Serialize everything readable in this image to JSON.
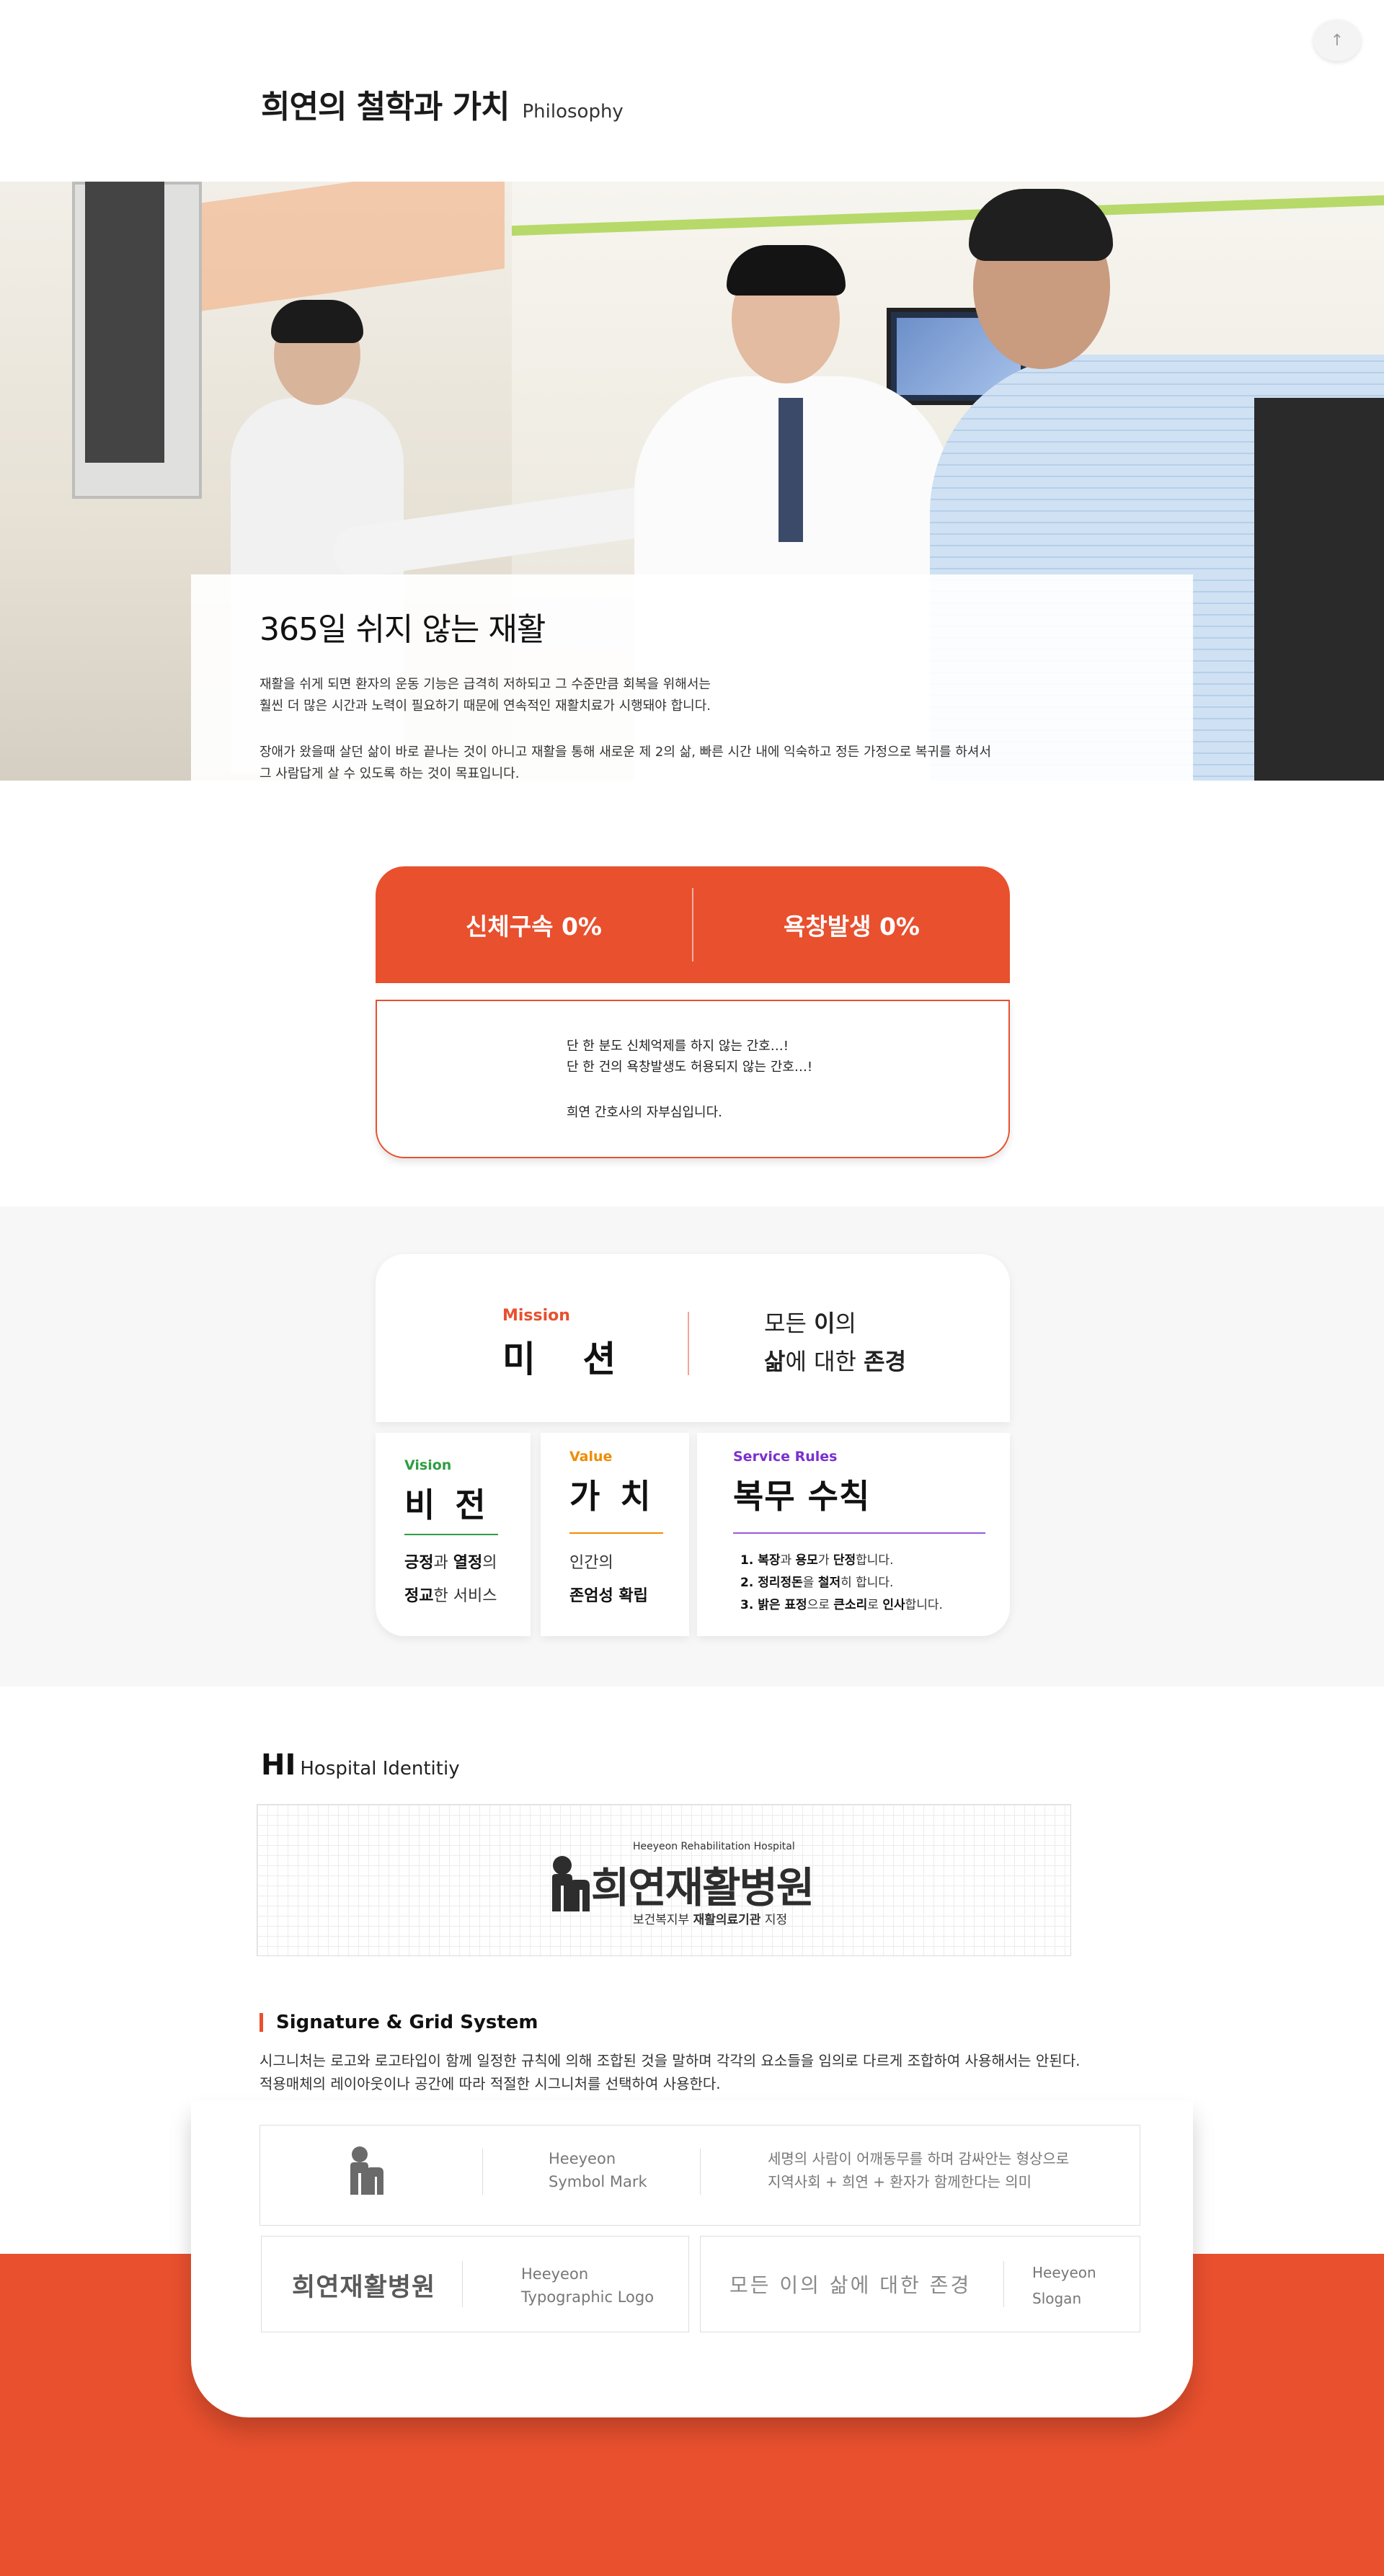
{
  "top_button": {
    "icon": "arrow-up-icon"
  },
  "header": {
    "title": "희연의 철학과 가치",
    "subtitle": "Philosophy"
  },
  "hero": {
    "heading": "365일 쉬지 않는 재활",
    "para1_line1": "재활을 쉬게 되면 환자의 운동 기능은 급격히 저하되고 그 수준만큼 회복을 위해서는",
    "para1_line2": " 훨씬 더 많은 시간과 노력이 필요하기 때문에 연속적인 재활치료가 시행돼야 합니다.",
    "para2_line1": " 장애가 왔을때 살던 삶이 바로 끝나는 것이 아니고 재활을 통해 새로운 제 2의 삶, 빠른 시간 내에 익숙하고 정든 가정으로 복귀를 하셔서",
    "para2_line2": "그 사람답게 살 수 있도록 하는 것이 목표입니다."
  },
  "zero": {
    "item1": "신체구속 0%",
    "item2": "욕창발생 0%",
    "line1": "단 한 분도 신체억제를 하지 않는 간호…!",
    "line2": "단 한 건의 욕창발생도 허용되지 않는 간호…!",
    "line3": "희연 간호사의 자부심입니다."
  },
  "mission": {
    "tag": "Mission",
    "title": "미 션",
    "stmt_a": "모든 ",
    "stmt_b": "이",
    "stmt_c": "의",
    "stmt_d": "삶",
    "stmt_e": "에 대한 ",
    "stmt_f": "존경"
  },
  "vision": {
    "tag": "Vision",
    "title": "비 전",
    "l1_a": "긍정",
    "l1_b": "과 ",
    "l1_c": "열정",
    "l1_d": "의",
    "l2_a": "정교",
    "l2_b": "한 서비스"
  },
  "value": {
    "tag": "Value",
    "title": "가 치",
    "l1": "인간의",
    "l2": "존엄성 확립"
  },
  "rules": {
    "tag": "Service Rules",
    "title": "복무 수칙",
    "r1_a": "1. 복장",
    "r1_b": "과 ",
    "r1_c": "용모",
    "r1_d": "가 ",
    "r1_e": "단정",
    "r1_f": "합니다.",
    "r2_a": "2. 정리정돈",
    "r2_b": "을 ",
    "r2_c": "철저",
    "r2_d": "히 합니다.",
    "r3_a": "3. 밝은 표정",
    "r3_b": "으로 ",
    "r3_c": "큰소리",
    "r3_d": "로 ",
    "r3_e": "인사",
    "r3_f": "합니다."
  },
  "hi": {
    "title_a": "HI",
    "title_b": "Hospital Identitiy",
    "logo_sub": "Heeyeon Rehabilitation Hospital",
    "logo_main": "희연재활병원",
    "caption_a": "보건복지부 ",
    "caption_b": "재활의료기관",
    "caption_c": " 지정"
  },
  "signature": {
    "title": "Signature & Grid System",
    "desc1": "시그니처는 로고와 로고타입이 함께 일정한 규칙에 의해 조합된 것을 말하며 각각의 요소들을 임의로 다르게 조합하여 사용해서는 안된다.",
    "desc2": "적용매체의 레이아웃이나 공간에 따라 적절한 시그니처를 선택하여 사용한다.",
    "symbol_label1": "Heeyeon",
    "symbol_label2": "Symbol Mark",
    "symbol_desc1": "세명의 사람이 어깨동무를 하며 감싸안는 형상으로",
    "symbol_desc2": "지역사회 + 희연 + 환자가 함께한다는 의미",
    "typo_text": "희연재활병원",
    "typo_label1": "Heeyeon",
    "typo_label2": "Typographic Logo",
    "slogan_text": "모든 이의 삶에 대한 존경",
    "slogan_label1": "Heeyeon",
    "slogan_label2": "Slogan"
  },
  "colors": {
    "accent": "#e8502e",
    "vision": "#2f9e44",
    "value": "#f08c00",
    "rules": "#7b2fd0"
  }
}
